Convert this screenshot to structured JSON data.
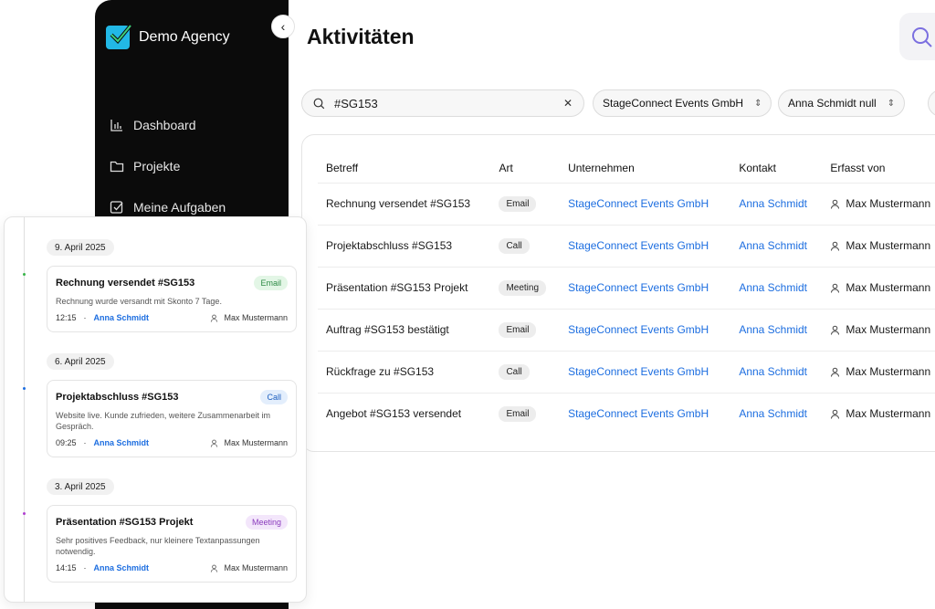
{
  "sidebar": {
    "brand": "Demo Agency",
    "items": [
      {
        "label": "Dashboard",
        "icon": "chart-icon"
      },
      {
        "label": "Projekte",
        "icon": "folder-icon"
      },
      {
        "label": "Meine Aufgaben",
        "icon": "checkbox-icon"
      }
    ]
  },
  "header": {
    "title": "Aktivitäten"
  },
  "filters": {
    "search_value": "#SG153",
    "company": "StageConnect Events GmbH",
    "contact": "Anna Schmidt null"
  },
  "table": {
    "columns": [
      "Betreff",
      "Art",
      "Unternehmen",
      "Kontakt",
      "Erfasst von"
    ],
    "rows": [
      {
        "subject": "Rechnung versendet #SG153",
        "type": "Email",
        "company": "StageConnect Events GmbH",
        "contact": "Anna Schmidt",
        "by": "Max Mustermann"
      },
      {
        "subject": "Projektabschluss #SG153",
        "type": "Call",
        "company": "StageConnect Events GmbH",
        "contact": "Anna Schmidt",
        "by": "Max Mustermann"
      },
      {
        "subject": "Präsentation #SG153 Projekt",
        "type": "Meeting",
        "company": "StageConnect Events GmbH",
        "contact": "Anna Schmidt",
        "by": "Max Mustermann"
      },
      {
        "subject": "Auftrag #SG153 bestätigt",
        "type": "Email",
        "company": "StageConnect Events GmbH",
        "contact": "Anna Schmidt",
        "by": "Max Mustermann"
      },
      {
        "subject": "Rückfrage zu #SG153",
        "type": "Call",
        "company": "StageConnect Events GmbH",
        "contact": "Anna Schmidt",
        "by": "Max Mustermann"
      },
      {
        "subject": "Angebot #SG153 versendet",
        "type": "Email",
        "company": "StageConnect Events GmbH",
        "contact": "Anna Schmidt",
        "by": "Max Mustermann"
      }
    ]
  },
  "timeline": [
    {
      "date": "9. April 2025",
      "title": "Rechnung versendet #SG153",
      "badge": "Email",
      "badge_bg": "#e3f6e6",
      "badge_color": "#2e8b46",
      "dot_color": "#39b54a",
      "desc": "Rechnung wurde versandt mit Skonto 7 Tage.",
      "time": "12:15",
      "contact": "Anna Schmidt",
      "by": "Max Mustermann"
    },
    {
      "date": "6. April 2025",
      "title": "Projektabschluss #SG153",
      "badge": "Call",
      "badge_bg": "#e3eefc",
      "badge_color": "#1d5fbf",
      "dot_color": "#1d6ee0",
      "desc": "Website live. Kunde zufrieden, weitere Zusammenarbeit im Gespräch.",
      "time": "09:25",
      "contact": "Anna Schmidt",
      "by": "Max Mustermann"
    },
    {
      "date": "3. April 2025",
      "title": "Präsentation #SG153 Projekt",
      "badge": "Meeting",
      "badge_bg": "#f3e6fb",
      "badge_color": "#8a3bbd",
      "dot_color": "#b040d0",
      "desc": "Sehr positives Feedback, nur kleinere Textanpassungen notwendig.",
      "time": "14:15",
      "contact": "Anna Schmidt",
      "by": "Max Mustermann"
    }
  ]
}
